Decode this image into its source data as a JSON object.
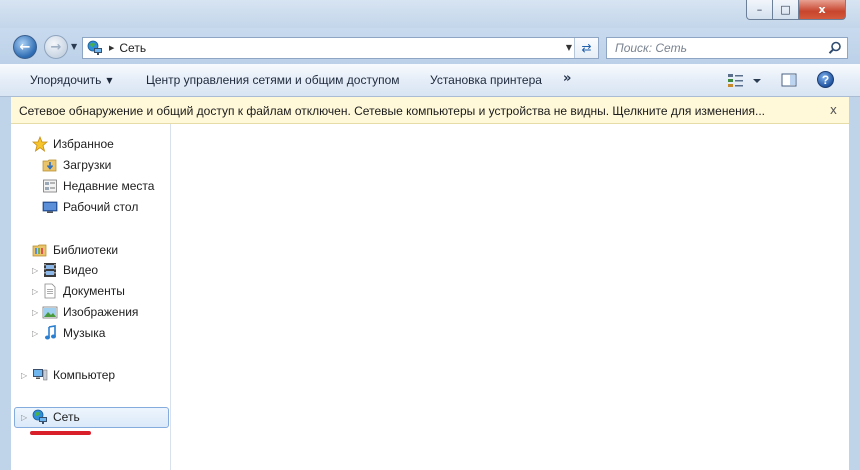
{
  "window": {
    "controls": {
      "minimize": "–",
      "maximize": "□",
      "close": "x"
    }
  },
  "address": {
    "location": "Сеть",
    "search_placeholder": "Поиск: Сеть"
  },
  "toolbar": {
    "organize": "Упорядочить",
    "network_center": "Центр управления сетями и общим доступом",
    "add_printer": "Установка принтера",
    "more": "»"
  },
  "infobar": {
    "message": "Сетевое обнаружение и общий доступ к файлам отключен. Сетевые компьютеры и устройства не видны. Щелкните для изменения...",
    "close": "x"
  },
  "sidebar": {
    "favorites": {
      "label": "Избранное",
      "items": [
        {
          "label": "Загрузки",
          "icon": "downloads-folder-icon"
        },
        {
          "label": "Недавние места",
          "icon": "recent-places-icon"
        },
        {
          "label": "Рабочий стол",
          "icon": "desktop-icon"
        }
      ]
    },
    "libraries": {
      "label": "Библиотеки",
      "items": [
        {
          "label": "Видео",
          "icon": "video-library-icon"
        },
        {
          "label": "Документы",
          "icon": "documents-library-icon"
        },
        {
          "label": "Изображения",
          "icon": "pictures-library-icon"
        },
        {
          "label": "Музыка",
          "icon": "music-library-icon"
        }
      ]
    },
    "computer": {
      "label": "Компьютер"
    },
    "network": {
      "label": "Сеть",
      "selected": true
    }
  },
  "colors": {
    "annotation_red": "#d81f2a",
    "infobar_bg": "#fff9d9",
    "selection_border": "#84acdd"
  }
}
